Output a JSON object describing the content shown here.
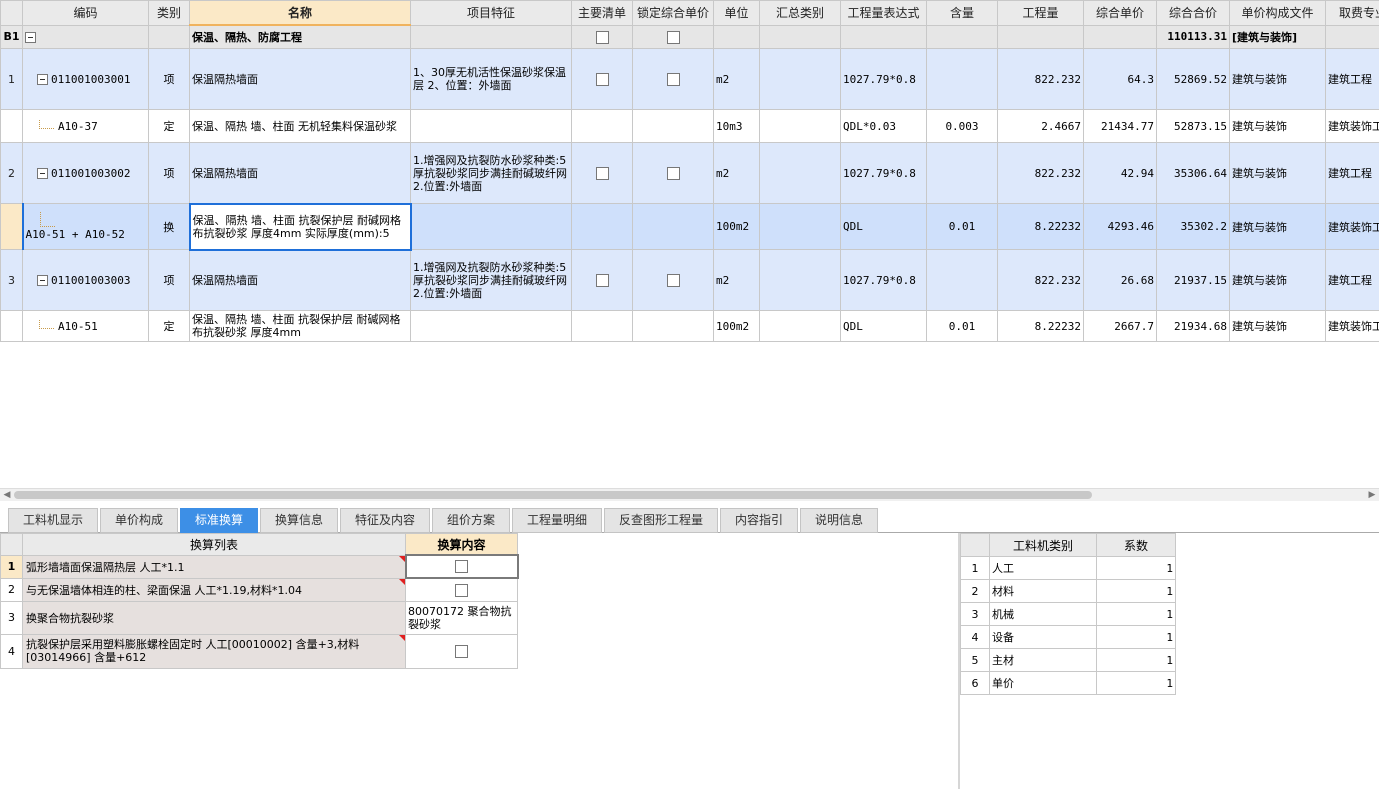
{
  "grid": {
    "headers": [
      "",
      "编码",
      "类别",
      "名称",
      "项目特征",
      "主要清单",
      "锁定综合单价",
      "单位",
      "汇总类别",
      "工程量表达式",
      "含量",
      "工程量",
      "综合单价",
      "综合合价",
      "单价构成文件",
      "取费专业"
    ],
    "b1": {
      "no": "B1",
      "name": "保温、隔热、防腐工程",
      "total": "110113.31",
      "file": "[建筑与装饰]"
    },
    "rows": [
      {
        "type": "qd",
        "no": "1",
        "code": "011001003001",
        "cat": "项",
        "name": "保温隔热墙面",
        "feature": "1、30厚无机活性保温砂浆保温层\n2、位置：外墙面",
        "unit": "m2",
        "expr": "1027.79*0.8",
        "content": "",
        "qty": "822.232",
        "price": "64.3",
        "total": "52869.52",
        "file": "建筑与装饰",
        "fee": "建筑工程"
      },
      {
        "type": "de",
        "no": "",
        "code": "A10-37",
        "cat": "定",
        "name": "保温、隔热 墙、柱面 无机轻集料保温砂浆",
        "feature": "",
        "unit": "10m3",
        "expr": "QDL*0.03",
        "content": "0.003",
        "qty": "2.4667",
        "price": "21434.77",
        "total": "52873.15",
        "file": "建筑与装饰",
        "fee": "建筑装饰工程"
      },
      {
        "type": "qd",
        "no": "2",
        "code": "011001003002",
        "cat": "项",
        "name": "保温隔热墙面",
        "feature": "1.增强网及抗裂防水砂浆种类:5厚抗裂砂浆同步满挂耐碱玻纤网\n2.位置:外墙面",
        "unit": "m2",
        "expr": "1027.79*0.8",
        "content": "",
        "qty": "822.232",
        "price": "42.94",
        "total": "35306.64",
        "file": "建筑与装饰",
        "fee": "建筑工程"
      },
      {
        "type": "huan",
        "no": "",
        "code": "A10-51 +\nA10-52",
        "cat": "换",
        "name": "保温、隔热 墙、柱面 抗裂保护层 耐碱网格布抗裂砂浆 厚度4mm  实际厚度(mm):5",
        "feature": "",
        "unit": "100m2",
        "expr": "QDL",
        "content": "0.01",
        "qty": "8.22232",
        "price": "4293.46",
        "total": "35302.2",
        "file": "建筑与装饰",
        "fee": "建筑装饰工程"
      },
      {
        "type": "qd",
        "no": "3",
        "code": "011001003003",
        "cat": "项",
        "name": "保温隔热墙面",
        "feature": "1.增强网及抗裂防水砂浆种类:5厚抗裂砂浆同步满挂耐碱玻纤网\n2.位置:外墙面",
        "unit": "m2",
        "expr": "1027.79*0.8",
        "content": "",
        "qty": "822.232",
        "price": "26.68",
        "total": "21937.15",
        "file": "建筑与装饰",
        "fee": "建筑工程"
      },
      {
        "type": "de",
        "no": "",
        "code": "A10-51",
        "cat": "定",
        "name": "保温、隔热 墙、柱面 抗裂保护层 耐碱网格布抗裂砂浆 厚度4mm",
        "feature": "",
        "unit": "100m2",
        "expr": "QDL",
        "content": "0.01",
        "qty": "8.22232",
        "price": "2667.7",
        "total": "21934.68",
        "file": "建筑与装饰",
        "fee": "建筑装饰工程"
      }
    ]
  },
  "tabs": [
    "工料机显示",
    "单价构成",
    "标准换算",
    "换算信息",
    "特征及内容",
    "组价方案",
    "工程量明细",
    "反查图形工程量",
    "内容指引",
    "说明信息"
  ],
  "active_tab": "标准换算",
  "conversion": {
    "headers": [
      "换算列表",
      "换算内容"
    ],
    "rows": [
      {
        "no": "1",
        "text": "弧形墙墙面保温隔热层 人工*1.1",
        "content": ""
      },
      {
        "no": "2",
        "text": "与无保温墙体相连的柱、梁面保温 人工*1.19,材料*1.04",
        "content": ""
      },
      {
        "no": "3",
        "text": "换聚合物抗裂砂浆",
        "content": "80070172  聚合物抗裂砂浆"
      },
      {
        "no": "4",
        "text": "抗裂保护层采用塑料膨胀螺栓固定时 人工[00010002] 含量+3,材料[03014966] 含量+612",
        "content": ""
      }
    ]
  },
  "coefficients": {
    "headers": [
      "工料机类别",
      "系数"
    ],
    "rows": [
      {
        "no": "1",
        "name": "人工",
        "value": "1"
      },
      {
        "no": "2",
        "name": "材料",
        "value": "1"
      },
      {
        "no": "3",
        "name": "机械",
        "value": "1"
      },
      {
        "no": "4",
        "name": "设备",
        "value": "1"
      },
      {
        "no": "5",
        "name": "主材",
        "value": "1"
      },
      {
        "no": "6",
        "name": "单价",
        "value": "1"
      }
    ]
  },
  "colors": {
    "accent": "#3d8fe6",
    "qd_row": "#dde8fb",
    "selected_row": "#cfe0fb",
    "header_sel": "#fbe9c7"
  }
}
